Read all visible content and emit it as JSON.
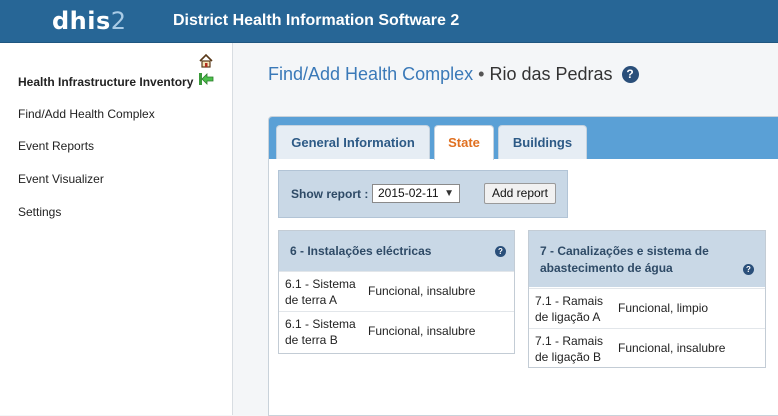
{
  "header": {
    "logo_main": "dhis",
    "logo_suffix": "2",
    "title": "District Health Information Software 2",
    "bg_color": "#276696"
  },
  "sidebar": {
    "icons": [
      "home-icon",
      "back-arrow-icon"
    ],
    "items": [
      {
        "label": "Health Infrastructure Inventory"
      },
      {
        "label": "Find/Add Health Complex"
      },
      {
        "label": "Event Reports"
      },
      {
        "label": "Event Visualizer"
      },
      {
        "label": "Settings"
      }
    ]
  },
  "page": {
    "title_link": "Find/Add Health Complex",
    "separator": "•",
    "title_entity": "Rio das Pedras",
    "help_glyph": "?"
  },
  "tabs": [
    {
      "label": "General Information"
    },
    {
      "label": "State"
    },
    {
      "label": "Buildings"
    }
  ],
  "report": {
    "label": "Show report :",
    "selected_date": "2015-02-11",
    "add_button": "Add report"
  },
  "cards": [
    {
      "title": "6 - Instalações eléctricas",
      "rows": [
        {
          "key": "6.1 - Sistema de terra A",
          "value": "Funcional, insalubre"
        },
        {
          "key": "6.1 - Sistema de terra B",
          "value": "Funcional, insalubre"
        }
      ]
    },
    {
      "title": "7 - Canalizações e sistema de abastecimento de água",
      "rows": [
        {
          "key": "7.1 - Ramais de ligação A",
          "value": "Funcional, limpio"
        },
        {
          "key": "7.1 - Ramais de ligação B",
          "value": "Funcional, insalubre"
        }
      ]
    }
  ],
  "colors": {
    "accent_tab_active": "#e07020",
    "tabbar": "#5aa0d6",
    "link": "#3a79b8"
  }
}
